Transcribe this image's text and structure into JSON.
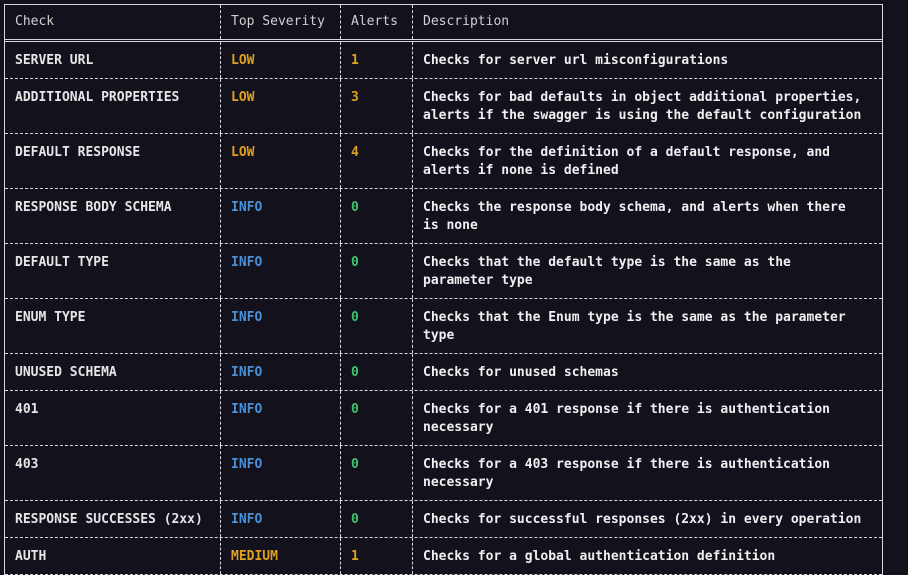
{
  "headers": {
    "check": "Check",
    "severity": "Top Severity",
    "alerts": "Alerts",
    "description": "Description"
  },
  "rows": [
    {
      "check": "SERVER URL",
      "severity": "LOW",
      "alerts": "1",
      "description": "Checks for server url misconfigurations"
    },
    {
      "check": "ADDITIONAL PROPERTIES",
      "severity": "LOW",
      "alerts": "3",
      "description": "Checks for bad defaults in object additional properties,\nalerts if the swagger is using the default configuration"
    },
    {
      "check": "DEFAULT RESPONSE",
      "severity": "LOW",
      "alerts": "4",
      "description": "Checks for the definition of a default response, and\nalerts if none is defined"
    },
    {
      "check": "RESPONSE BODY SCHEMA",
      "severity": "INFO",
      "alerts": "0",
      "description": "Checks the response body schema, and alerts when there\nis none"
    },
    {
      "check": "DEFAULT TYPE",
      "severity": "INFO",
      "alerts": "0",
      "description": "Checks that the default type is the same as the\nparameter type"
    },
    {
      "check": "ENUM TYPE",
      "severity": "INFO",
      "alerts": "0",
      "description": "Checks that the Enum type is the same as the parameter\ntype"
    },
    {
      "check": "UNUSED SCHEMA",
      "severity": "INFO",
      "alerts": "0",
      "description": "Checks for unused schemas"
    },
    {
      "check": "401",
      "severity": "INFO",
      "alerts": "0",
      "description": "Checks for a 401 response if there is authentication\nnecessary"
    },
    {
      "check": "403",
      "severity": "INFO",
      "alerts": "0",
      "description": "Checks for a 403 response if there is authentication\nnecessary"
    },
    {
      "check": "RESPONSE SUCCESSES (2xx)",
      "severity": "INFO",
      "alerts": "0",
      "description": "Checks for successful responses (2xx) in every operation"
    },
    {
      "check": "AUTH",
      "severity": "MEDIUM",
      "alerts": "1",
      "description": "Checks for a global authentication definition"
    }
  ]
}
